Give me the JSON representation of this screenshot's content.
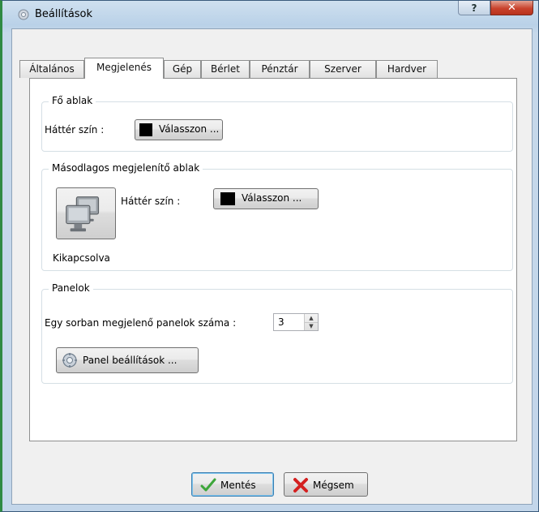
{
  "window": {
    "title": "Beállítások",
    "help_label": "?",
    "close_label": "✕"
  },
  "tabs": [
    {
      "label": "Általános",
      "active": false
    },
    {
      "label": "Megjelenés",
      "active": true
    },
    {
      "label": "Gép",
      "active": false
    },
    {
      "label": "Bérlet",
      "active": false
    },
    {
      "label": "Pénztár",
      "active": false
    },
    {
      "label": "Szerver",
      "active": false
    },
    {
      "label": "Hardver",
      "active": false
    }
  ],
  "main_window": {
    "group_title": "Fő ablak",
    "bg_label": "Háttér szín :",
    "choose_label": "Válasszon ...",
    "swatch_color": "#000000"
  },
  "secondary_window": {
    "group_title": "Másodlagos megjelenítő ablak",
    "bg_label": "Háttér szín :",
    "choose_label": "Válasszon ...",
    "swatch_color": "#000000",
    "monitor_icon": "monitors-icon",
    "status": "Kikapcsolva"
  },
  "panels": {
    "group_title": "Panelok",
    "count_label": "Egy sorban megjelenő panelok száma :",
    "count_value": "3",
    "settings_label": "Panel beállítások ...",
    "settings_icon": "gear-icon"
  },
  "footer": {
    "save_label": "Mentés",
    "save_icon": "checkmark-icon",
    "cancel_label": "Mégsem",
    "cancel_icon": "red-x-icon"
  }
}
